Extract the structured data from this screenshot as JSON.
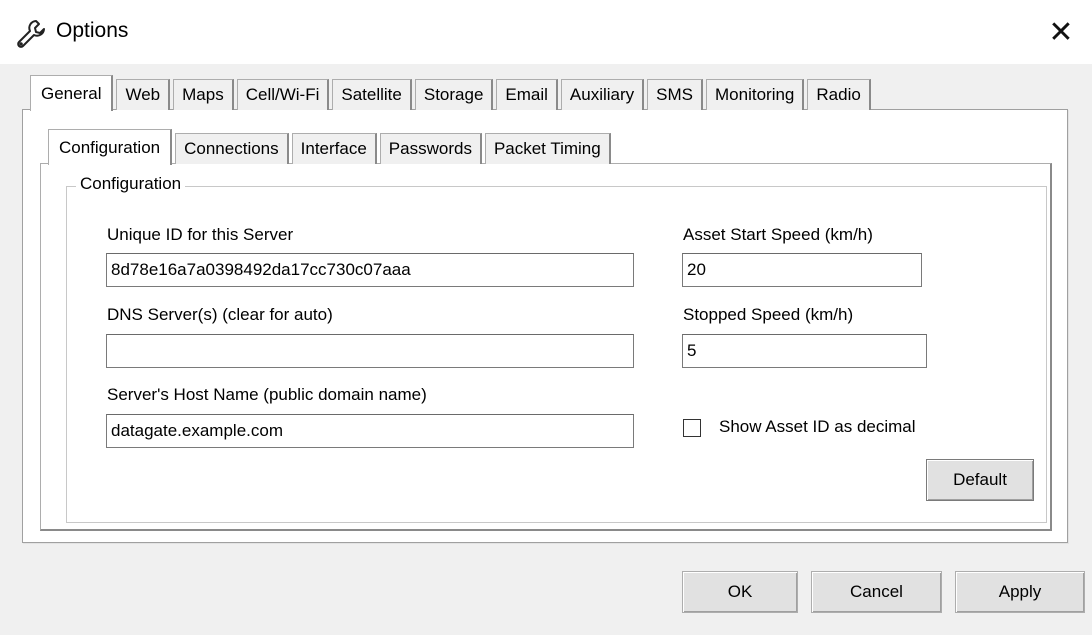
{
  "window": {
    "title": "Options",
    "icon": "wrench-icon",
    "close_glyph": "✕"
  },
  "outer_tabs": [
    {
      "label": "General",
      "active": true
    },
    {
      "label": "Web"
    },
    {
      "label": "Maps"
    },
    {
      "label": "Cell/Wi-Fi"
    },
    {
      "label": "Satellite"
    },
    {
      "label": "Storage"
    },
    {
      "label": "Email"
    },
    {
      "label": "Auxiliary"
    },
    {
      "label": "SMS"
    },
    {
      "label": "Monitoring"
    },
    {
      "label": "Radio"
    }
  ],
  "inner_tabs": [
    {
      "label": "Configuration",
      "active": true
    },
    {
      "label": "Connections"
    },
    {
      "label": "Interface"
    },
    {
      "label": "Passwords"
    },
    {
      "label": "Packet Timing"
    }
  ],
  "group": {
    "title": "Configuration"
  },
  "fields": {
    "unique_id_label": "Unique ID for this Server",
    "unique_id_value": "8d78e16a7a0398492da17cc730c07aaa",
    "dns_label": "DNS Server(s) (clear for auto)",
    "dns_value": "",
    "host_label": "Server's Host Name (public domain name)",
    "host_value": "datagate.example.com",
    "start_speed_label": "Asset Start Speed (km/h)",
    "start_speed_value": "20",
    "stopped_speed_label": "Stopped Speed (km/h)",
    "stopped_speed_value": "5",
    "show_asset_label": "Show Asset ID as decimal",
    "show_asset_checked": false
  },
  "buttons": {
    "default": "Default",
    "ok": "OK",
    "cancel": "Cancel",
    "apply": "Apply"
  }
}
